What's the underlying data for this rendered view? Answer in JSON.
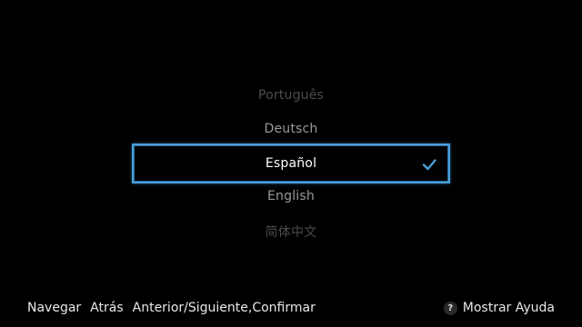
{
  "languages": {
    "portuguese": "Português",
    "german": "Deutsch",
    "selected": "Español",
    "english": "English",
    "chinese": "简体中文"
  },
  "footer": {
    "navigate": "Navegar",
    "back": "Atrás",
    "prev_next_confirm": "Anterior/Siguiente,Confirmar",
    "help_key": "?",
    "help_label": "Mostrar Ayuda"
  },
  "colors": {
    "selection_border": "#4a9fd9",
    "background": "#000000"
  },
  "icons": {
    "selected_marker": "check-icon"
  }
}
